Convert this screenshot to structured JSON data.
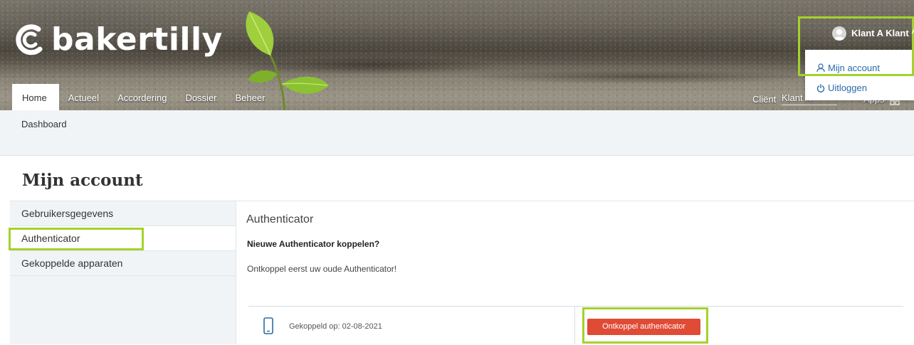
{
  "brand": {
    "logo_text": "bakertilly",
    "highlight_color": "#a4d22c",
    "button_color": "#e04b35",
    "link_color": "#2b6aa8"
  },
  "nav": {
    "tabs": [
      {
        "label": "Home",
        "active": true
      },
      {
        "label": "Actueel"
      },
      {
        "label": "Accordering"
      },
      {
        "label": "Dossier"
      },
      {
        "label": "Beheer"
      }
    ],
    "client_label": "Cliënt",
    "client_value": "Klant A",
    "apps_label": "Apps"
  },
  "user_menu": {
    "name": "Klant A Klant",
    "items": [
      {
        "label": "Mijn account",
        "icon": "user-icon"
      },
      {
        "label": "Uitloggen",
        "icon": "power-icon"
      }
    ]
  },
  "breadcrumb": "Dashboard",
  "page_title": "Mijn account",
  "sidebar": {
    "items": [
      {
        "label": "Gebruikersgegevens"
      },
      {
        "label": "Authenticator",
        "active": true
      },
      {
        "label": "Gekoppelde apparaten"
      }
    ]
  },
  "content": {
    "heading": "Authenticator",
    "subheading": "Nieuwe Authenticator koppelen?",
    "message": "Ontkoppel eerst uw oude Authenticator!",
    "device": {
      "icon": "phone-icon",
      "linked_text": "Gekoppeld op: 02-08-2021",
      "button_label": "Ontkoppel authenticator"
    }
  }
}
